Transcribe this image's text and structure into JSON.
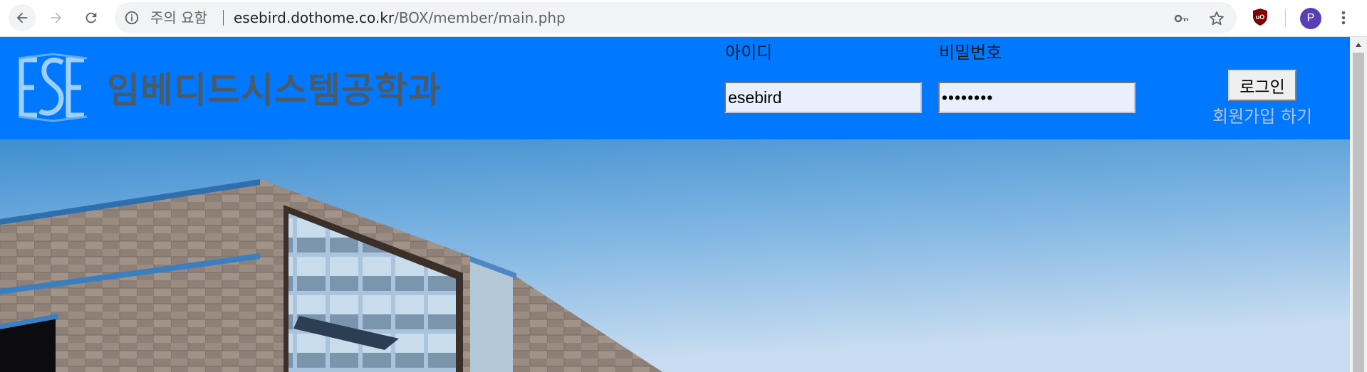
{
  "browser": {
    "security_label": "주의 요함",
    "url_host": "esebird.dothome.co.kr",
    "url_path": "/BOX/member/main.php",
    "profile_initial": "P",
    "icons": [
      "back-arrow-icon",
      "forward-arrow-icon",
      "reload-icon",
      "info-icon",
      "key-icon",
      "star-icon",
      "ublock-icon",
      "kebab-menu-icon"
    ]
  },
  "header": {
    "logo_text": "ESE",
    "title": "임베디드시스템공학과",
    "background_color": "#0078ff"
  },
  "login": {
    "id_label": "아이디",
    "id_value": "esebird",
    "pw_label": "비밀번호",
    "pw_value": "esebird1",
    "login_button": "로그인",
    "signup_link": "회원가입 하기"
  }
}
